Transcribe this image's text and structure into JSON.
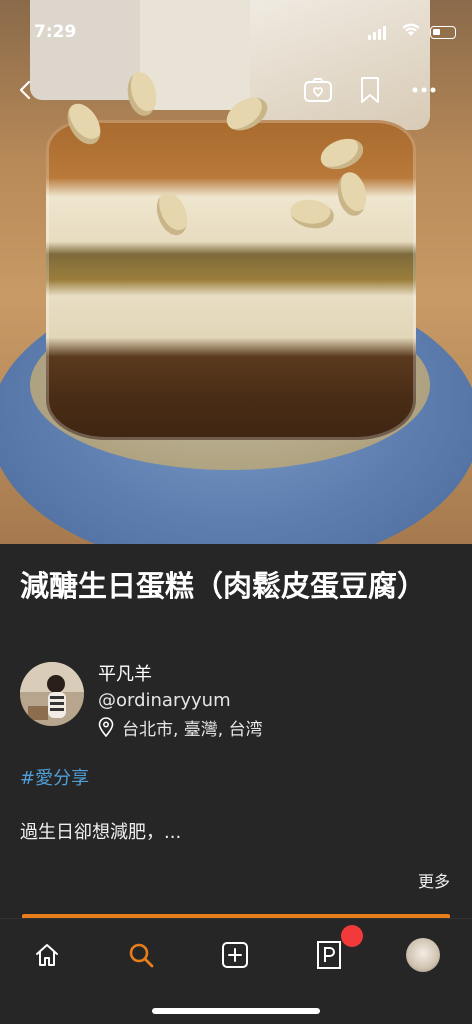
{
  "status_bar": {
    "time": "7:29"
  },
  "header": {
    "back_icon": "chevron-left-icon",
    "camera_icon": "camera-heart-icon",
    "bookmark_icon": "bookmark-icon",
    "more_icon": "ellipsis-icon"
  },
  "post": {
    "title": "減醣生日蛋糕（肉鬆皮蛋豆腐）",
    "author": {
      "name": "平凡羊",
      "handle": "@ordinaryyum",
      "location": "台北市, 臺灣, 台湾"
    },
    "hashtag": "#愛分享",
    "description": "過生日卻想減肥，...",
    "more_label": "更多"
  },
  "tabbar": {
    "items": [
      {
        "name": "home",
        "icon": "home-icon",
        "active": false
      },
      {
        "name": "search",
        "icon": "search-icon",
        "active": true
      },
      {
        "name": "add",
        "icon": "add-square-icon",
        "active": false
      },
      {
        "name": "magazine",
        "icon": "magazine-icon",
        "active": false,
        "badge": true
      },
      {
        "name": "profile",
        "icon": "avatar",
        "active": false
      }
    ]
  },
  "colors": {
    "background": "#262626",
    "accent": "#e77d1b",
    "hashtag": "#4f9fd6",
    "badge": "#f23a3a"
  }
}
